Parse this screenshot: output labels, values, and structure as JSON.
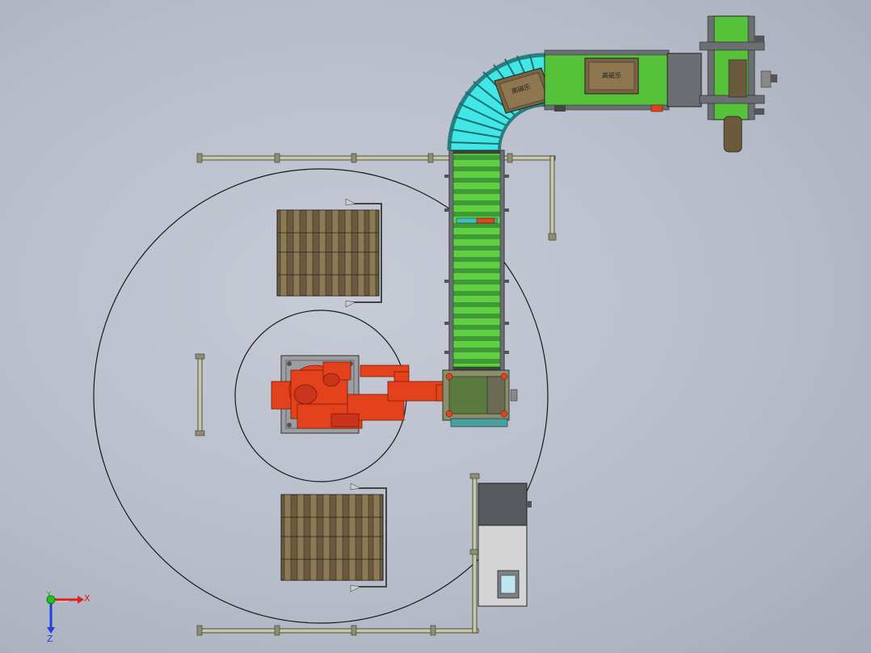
{
  "scene": {
    "box_label_1": "高磁乐",
    "box_label_2": "高磁乐"
  },
  "axes": {
    "x_label": "X",
    "y_label": "Y",
    "z_label": "Z"
  },
  "colors": {
    "background": "#b9bfcb",
    "robot": "#e3421d",
    "conveyor_green": "#56c23a",
    "roller_cyan": "#41e6e6",
    "pallet_wood": "#6b5a3c",
    "cabinet": "#cfcfcf",
    "outline": "#222222"
  },
  "icons": {
    "triad": "coordinate-triad-icon"
  }
}
